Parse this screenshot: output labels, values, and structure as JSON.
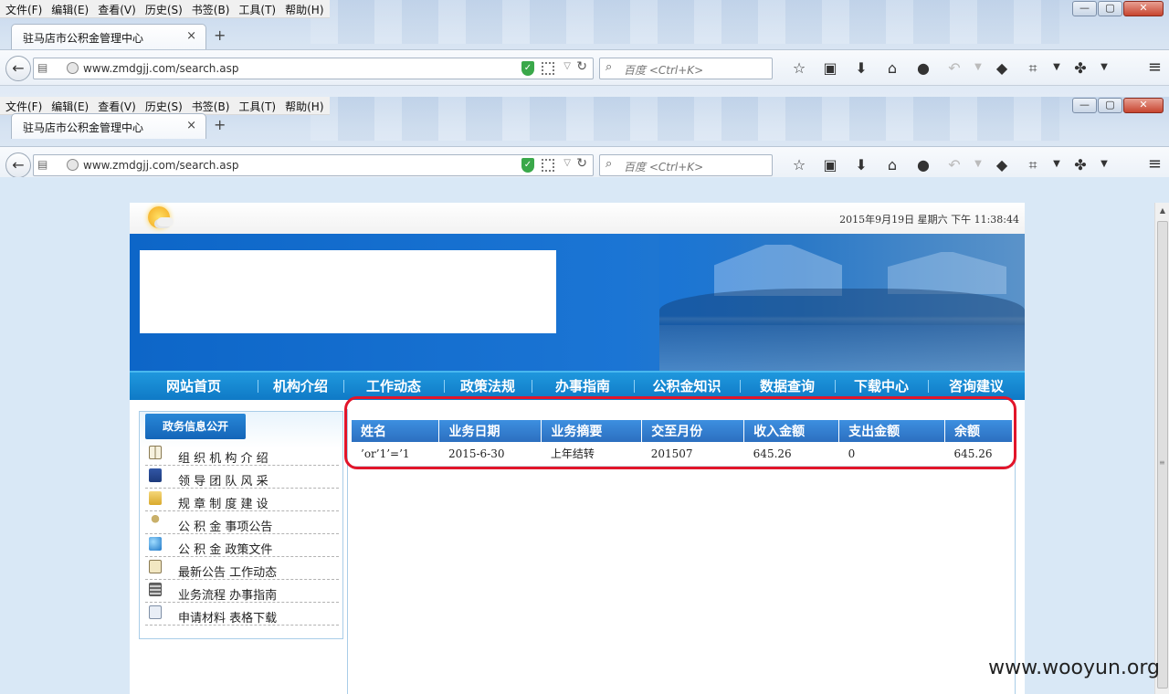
{
  "browser": {
    "menu": [
      "文件(F)",
      "编辑(E)",
      "查看(V)",
      "历史(S)",
      "书签(B)",
      "工具(T)",
      "帮助(H)"
    ],
    "window_controls": [
      "—",
      "▢",
      "✕"
    ],
    "tab_title": "驻马店市公积金管理中心",
    "tab_close": "×",
    "new_tab": "+",
    "url": "www.zmdgjj.com/search.asp",
    "search_placeholder": "百度 <Ctrl+K>",
    "back": "←"
  },
  "site": {
    "datetime": "2015年9月19日 星期六 下午 11:38:44",
    "nav": [
      "网站首页",
      "机构介绍",
      "工作动态",
      "政策法规",
      "办事指南",
      "公积金知识",
      "数据查询",
      "下载中心",
      "咨询建议"
    ],
    "sidebar": {
      "title": "政务信息公开",
      "items": [
        {
          "label": "组 织 机 构 介 绍",
          "icon": "book-icon"
        },
        {
          "label": "领 导 团 队 风 采",
          "icon": "blue-book-icon"
        },
        {
          "label": "规 章 制 度 建 设",
          "icon": "folder-icon"
        },
        {
          "label": "公 积 金 事项公告",
          "icon": "pin-icon"
        },
        {
          "label": "公 积 金 政策文件",
          "icon": "globe-icon"
        },
        {
          "label": "最新公告 工作动态",
          "icon": "clipboard-icon"
        },
        {
          "label": "业务流程 办事指南",
          "icon": "calculator-icon"
        },
        {
          "label": "申请材料 表格下载",
          "icon": "document-icon"
        }
      ]
    },
    "table": {
      "columns": [
        "姓名",
        "业务日期",
        "业务摘要",
        "交至月份",
        "收入金额",
        "支出金额",
        "余额"
      ],
      "rows": [
        [
          "’or’1’=’1",
          "2015-6-30",
          "上年结转",
          "201507",
          "645.26",
          "0",
          "645.26"
        ]
      ]
    }
  },
  "watermark": "www.wooyun.org",
  "colors": {
    "accent": "#1b75d4",
    "highlight_ring": "#e2152a"
  }
}
